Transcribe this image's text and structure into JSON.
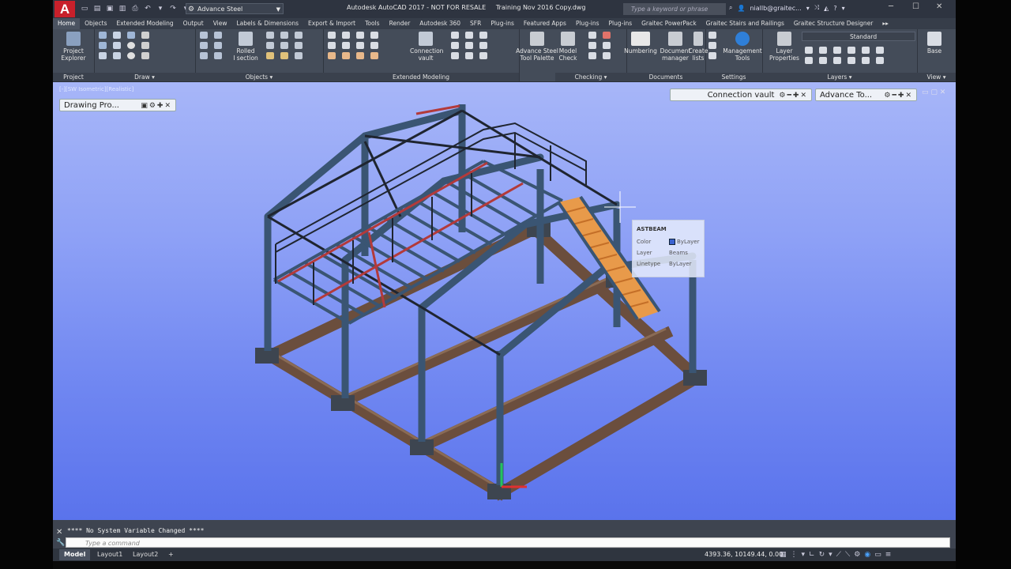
{
  "titlebar": {
    "logo": "A",
    "workspace": "Advance Steel",
    "title": "Autodesk AutoCAD 2017 - NOT FOR RESALE     Training Nov 2016 Copy.dwg",
    "search_placeholder": "Type a keyword or phrase",
    "user": "niallb@graitec...",
    "help": "?"
  },
  "tabs": [
    "Home",
    "Objects",
    "Extended Modeling",
    "Output",
    "View",
    "Labels & Dimensions",
    "Export & Import",
    "Tools",
    "Render",
    "Autodesk 360",
    "SFR",
    "Plug-ins",
    "Featured Apps",
    "Plug-ins",
    "Plug-ins",
    "Graitec PowerPack",
    "Graitec Stairs and Railings",
    "Graitec Structure Designer"
  ],
  "ribbon": {
    "project_explorer": "Project\nExplorer",
    "rolled_section": "Rolled\nI section",
    "connection_vault": "Connection\nvault",
    "advance_steel_palette": "Advance Steel\nTool Palette",
    "model_check": "Model\nCheck",
    "numbering": "Numbering",
    "document_manager": "Document\nmanager",
    "create_lists": "Create\nlists",
    "management_tools": "Management\nTools",
    "layer_properties": "Layer\nProperties",
    "layer_name": "Standard",
    "base": "Base",
    "panels": {
      "project": "Project",
      "draw": "Draw ▾",
      "objects": "Objects ▾",
      "extended_modeling": "Extended Modeling",
      "checking": "Checking ▾",
      "documents": "Documents",
      "settings": "Settings",
      "layers": "Layers ▾",
      "view": "View ▾"
    }
  },
  "viewport": {
    "label": "[-][SW Isometric][Realistic]",
    "palette_drawing": "Drawing Pro...",
    "palette_connection": "Connection vault",
    "palette_advance": "Advance To..."
  },
  "tooltip": {
    "title": "ASTBEAM",
    "rows": [
      {
        "key": "Color",
        "value": "ByLayer"
      },
      {
        "key": "Layer",
        "value": "Beams"
      },
      {
        "key": "Linetype",
        "value": "ByLayer"
      }
    ]
  },
  "command": {
    "history": "**** No System Variable Changed ****",
    "placeholder": "Type a command"
  },
  "status": {
    "tabs": [
      "Model",
      "Layout1",
      "Layout2"
    ],
    "add": "+",
    "coordinates": "4393.36, 10149.44, 0.00"
  },
  "colors": {
    "steel": "#3a5573",
    "rail": "#b33a3a",
    "stair": "#e89a4a",
    "background_top": "#a7b6f8",
    "background_bottom": "#5a73ec"
  }
}
